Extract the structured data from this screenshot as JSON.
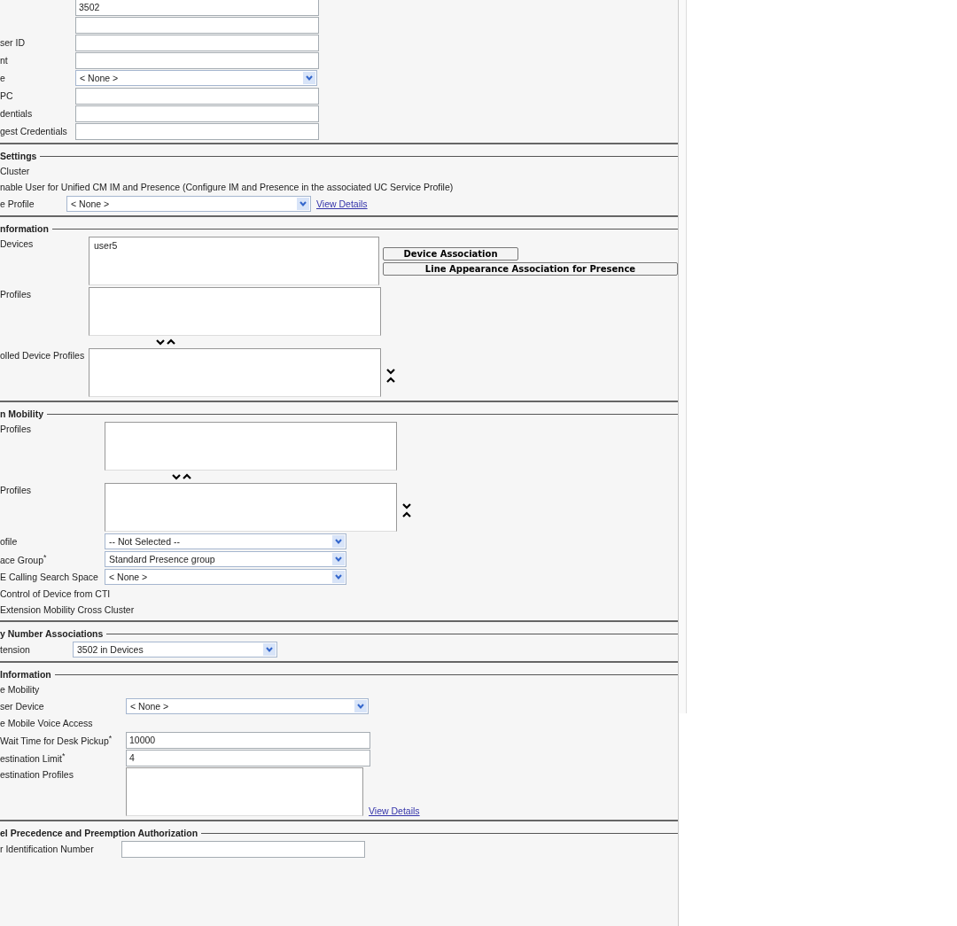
{
  "sections": [
    {
      "rows": [
        {
          "kind": "input",
          "value": "3502"
        },
        {
          "kind": "input"
        },
        {
          "kind": "input",
          "label": "ser ID"
        },
        {
          "kind": "input",
          "label": "nt"
        },
        {
          "kind": "select",
          "label": "e",
          "value": "< None >"
        },
        {
          "kind": "input",
          "label": "PC"
        },
        {
          "kind": "input",
          "label": "dentials"
        },
        {
          "kind": "input",
          "label": "gest Credentials"
        }
      ]
    },
    {
      "title": "Settings",
      "rows": [
        {
          "kind": "text",
          "label": "Cluster"
        },
        {
          "kind": "text",
          "label": "nable User for Unified CM IM and Presence (Configure IM and Presence in the associated UC Service Profile)"
        },
        {
          "kind": "select",
          "label": "e Profile",
          "value": "< None >",
          "link": "View Details"
        }
      ]
    },
    {
      "title": "nformation",
      "rows": [
        {
          "kind": "list",
          "label": "Devices",
          "items": [
            "user5"
          ],
          "buttons": [
            "Device Association",
            "Line Appearance Association for Presence"
          ]
        },
        {
          "kind": "list",
          "label": "Profiles"
        },
        {
          "kind": "move"
        },
        {
          "kind": "list",
          "label": "olled Device Profiles",
          "side_move": true
        }
      ]
    },
    {
      "title": "n Mobility",
      "rows": [
        {
          "kind": "list",
          "label": "Profiles"
        },
        {
          "kind": "move"
        },
        {
          "kind": "list",
          "label": "Profiles",
          "side_move": true
        },
        {
          "kind": "select",
          "label": "ofile",
          "value": "-- Not Selected --"
        },
        {
          "kind": "select",
          "label": "ace Group$^{*}$",
          "value": "Standard Presence group"
        },
        {
          "kind": "select",
          "label": "E Calling Search Space",
          "value": "< None >"
        },
        {
          "kind": "text",
          "label": "Control of Device from CTI"
        },
        {
          "kind": "text",
          "label": "Extension Mobility Cross Cluster"
        }
      ]
    },
    {
      "title": "y Number Associations",
      "rows": [
        {
          "kind": "select",
          "label": "tension",
          "value": "3502 in Devices"
        }
      ]
    },
    {
      "title": "Information",
      "rows": [
        {
          "kind": "text",
          "label": "e Mobility"
        },
        {
          "kind": "select",
          "label": "ser Device",
          "value": "< None >"
        },
        {
          "kind": "text",
          "label": "e Mobile Voice Access"
        },
        {
          "kind": "input",
          "label": "Wait Time for Desk Pickup$^{*}$",
          "value": "10000"
        },
        {
          "kind": "input",
          "label": "estination Limit$^{*}$",
          "value": "4"
        },
        {
          "kind": "list",
          "label": "estination Profiles",
          "link": "View Details"
        }
      ]
    },
    {
      "title": "el Precedence and Preemption Authorization",
      "rows": [
        {
          "kind": "input",
          "label": "r Identification Number"
        }
      ]
    }
  ]
}
